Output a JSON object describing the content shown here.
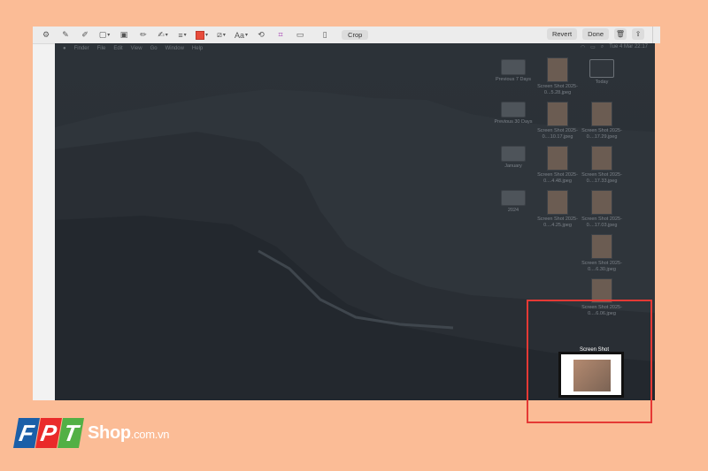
{
  "toolbar": {
    "crop_label": "Crop",
    "revert_label": "Revert",
    "done_label": "Done",
    "text_style_label": "Aa",
    "icons": [
      "gear-icon",
      "sketch-icon",
      "draw-icon",
      "shapes-icon",
      "text-box-icon",
      "highlight-icon",
      "sign-icon",
      "lines-icon",
      "border-color-icon",
      "fill-color-icon",
      "text-style-icon",
      "rotate-icon",
      "crop-tool-icon",
      "note-icon",
      "device-icon",
      "crop-button",
      "trash-icon",
      "share-icon"
    ]
  },
  "menubar": {
    "items": [
      "Finder",
      "File",
      "Edit",
      "View",
      "Go",
      "Window",
      "Help"
    ],
    "clock": "Tue 4 Mar  22:17"
  },
  "desktop_items": [
    {
      "label": "Previous 7 Days",
      "type": "folder"
    },
    {
      "label": "Screen Shot 2025-0...5.28.jpeg",
      "type": "screen"
    },
    {
      "label": "Today",
      "type": "monitor"
    },
    {
      "label": "Previous 30 Days",
      "type": "folder"
    },
    {
      "label": "Screen Shot 2025-0....10.17.jpeg",
      "type": "screen"
    },
    {
      "label": "Screen Shot 2025-0....17.29.jpeg",
      "type": "screen"
    },
    {
      "label": "January",
      "type": "folder"
    },
    {
      "label": "Screen Shot 2025-0....4.48.jpeg",
      "type": "screen"
    },
    {
      "label": "Screen Shot 2025-0....17.33.jpeg",
      "type": "screen"
    },
    {
      "label": "2024",
      "type": "folder"
    },
    {
      "label": "Screen Shot 2025-0....4.25.jpeg",
      "type": "screen"
    },
    {
      "label": "Screen Shot 2025-0....17.03.jpeg",
      "type": "screen"
    },
    {
      "label": "Screen Shot 2025-0....6.30.jpeg",
      "type": "screen"
    },
    {
      "label": "Screen Shot 2025-0....6.06.jpeg",
      "type": "screen"
    }
  ],
  "drag_label": "Screen Shot",
  "brand": {
    "letters": [
      "F",
      "P",
      "T"
    ],
    "name": "Shop",
    "domain": ".com.vn"
  },
  "colors": {
    "highlight": "#e53935",
    "background": "#fbbc96",
    "fpt_blue": "#1b5fa8",
    "fpt_red": "#ea2b2a",
    "fpt_green": "#52b045"
  }
}
